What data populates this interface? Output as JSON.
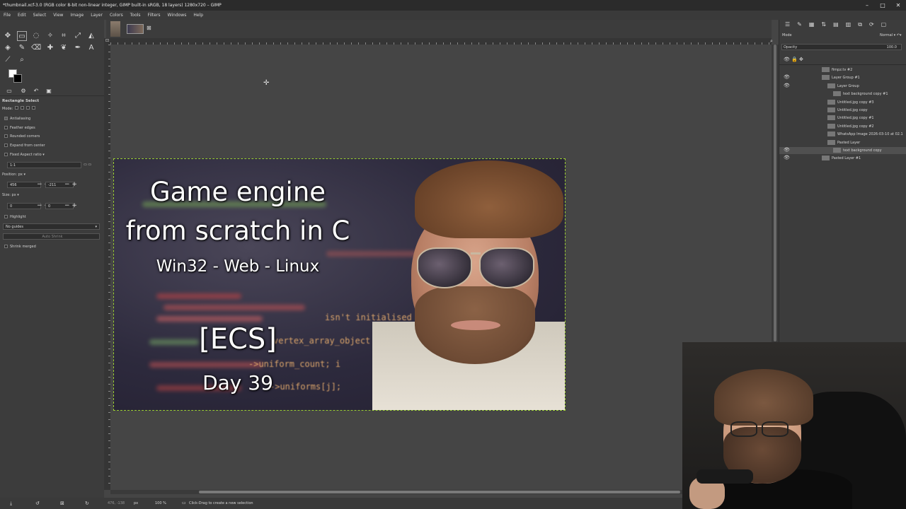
{
  "window": {
    "title": "*thumbnail.xcf-3.0 (RGB color 8-bit non-linear integer, GIMP built-in sRGB, 18 layers) 1280x720 – GIMP",
    "controls": [
      "–",
      "□",
      "✕"
    ]
  },
  "menu": [
    "File",
    "Edit",
    "Select",
    "View",
    "Image",
    "Layer",
    "Colors",
    "Tools",
    "Filters",
    "Windows",
    "Help"
  ],
  "tool_options": {
    "tool_name": "Rectangle Select",
    "mode_label": "Mode:",
    "antialiasing": "Antialiasing",
    "feather_edges": "Feather edges",
    "rounded_corners": "Rounded corners",
    "expand_from_center": "Expand from center",
    "fixed_label": "Fixed  Aspect ratio",
    "ratio_value": "1:1",
    "position_label": "Position:",
    "position_unit": "px",
    "pos_x": "456",
    "pos_y": "-211",
    "size_label": "Size:",
    "size_unit": "px",
    "size_w": "0",
    "size_h": "0",
    "highlight": "Highlight",
    "guides": "No guides",
    "auto_shrink": "Auto Shrink",
    "shrink_merged": "Shrink merged"
  },
  "thumbnail": {
    "title_line1": "Game engine",
    "title_line2": "from scratch in C",
    "platforms": "Win32 - Web - Linux",
    "tag": "[ECS]",
    "day": "Day 39",
    "code_1": "isn't initialised",
    "code_2": "vertex_array_object",
    "code_3": "->uniform_count; i",
    "code_4": "->uniforms[j];"
  },
  "layers_panel": {
    "mode_label": "Mode",
    "mode_value": "Normal",
    "opacity_label": "Opacity",
    "opacity_value": "100.0",
    "layers": [
      {
        "name": "fimpz.tv #2",
        "indent": 0,
        "visible": false
      },
      {
        "name": "Layer Group #1",
        "indent": 0,
        "visible": true
      },
      {
        "name": "Layer Group",
        "indent": 1,
        "visible": true
      },
      {
        "name": "text background copy #1",
        "indent": 2,
        "visible": false
      },
      {
        "name": "Untitled.jpg copy #3",
        "indent": 1,
        "visible": false
      },
      {
        "name": "Untitled.jpg copy",
        "indent": 1,
        "visible": false
      },
      {
        "name": "Untitled.jpg copy #1",
        "indent": 1,
        "visible": false
      },
      {
        "name": "Untitled.jpg copy #2",
        "indent": 1,
        "visible": false
      },
      {
        "name": "WhatsApp Image 2026-03-10 at 02.1",
        "indent": 1,
        "visible": false
      },
      {
        "name": "Pasted Layer",
        "indent": 1,
        "visible": false
      },
      {
        "name": "text background copy",
        "indent": 2,
        "visible": true
      },
      {
        "name": "Pasted Layer #1",
        "indent": 0,
        "visible": true
      }
    ]
  },
  "status": {
    "coords": "476, -138",
    "unit": "px",
    "zoom": "100 %",
    "message": "Click-Drag to create a new selection"
  }
}
